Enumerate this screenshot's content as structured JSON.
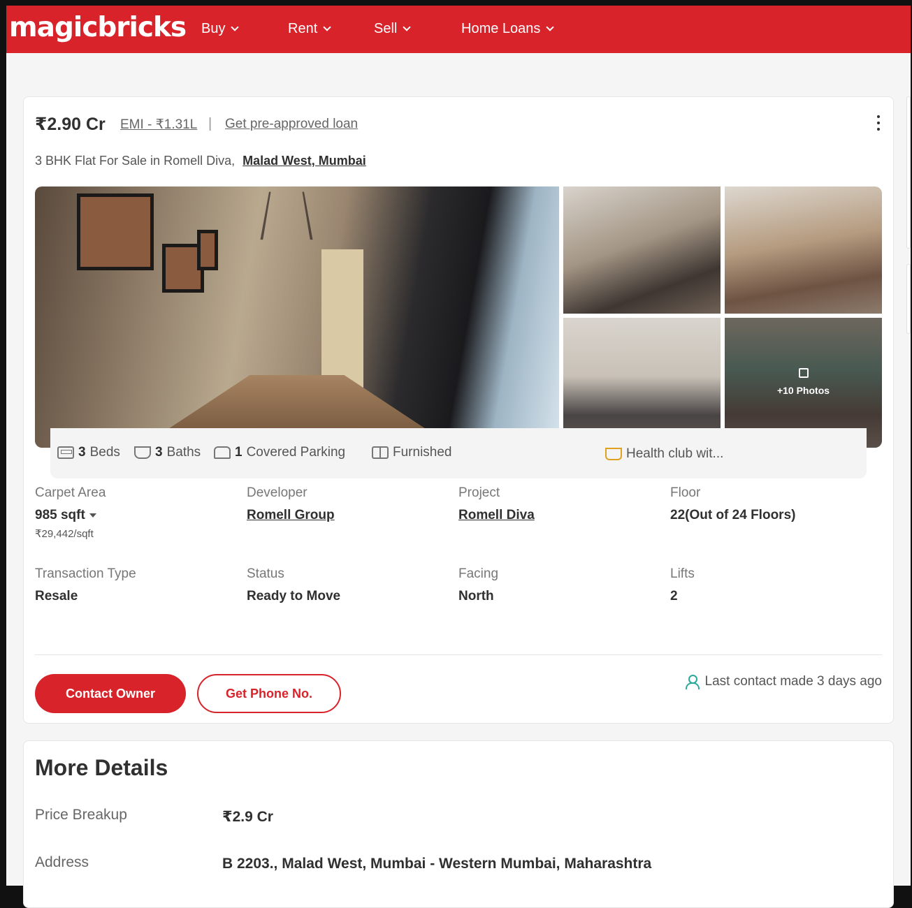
{
  "header": {
    "logo": "magicbricks",
    "nav": [
      {
        "label": "Buy"
      },
      {
        "label": "Rent"
      },
      {
        "label": "Sell"
      },
      {
        "label": "Home Loans"
      }
    ],
    "brand_color": "#d8232a"
  },
  "listing": {
    "price": "₹2.90 Cr",
    "emi": "EMI - ₹1.31L",
    "separator": "|",
    "loan_link": "Get pre-approved loan",
    "title_text": "3 BHK Flat For Sale in Romell Diva,",
    "location_link": "Malad West, Mumbai",
    "photos_label": "+10 Photos",
    "features": {
      "beds_count": "3",
      "beds_label": "Beds",
      "baths_count": "3",
      "baths_label": "Baths",
      "parking_count": "1",
      "parking_label": "Covered Parking",
      "furnishing": "Furnished",
      "amenity": "Health club wit..."
    },
    "details": {
      "carpet_area_label": "Carpet Area",
      "carpet_area_value": "985 sqft",
      "price_per_sqft": "₹29,442/sqft",
      "developer_label": "Developer",
      "developer_value": "Romell Group",
      "project_label": "Project",
      "project_value": "Romell Diva",
      "floor_label": "Floor",
      "floor_value": "22(Out of 24 Floors)",
      "transaction_label": "Transaction Type",
      "transaction_value": "Resale",
      "status_label": "Status",
      "status_value": "Ready to Move",
      "facing_label": "Facing",
      "facing_value": "North",
      "lifts_label": "Lifts",
      "lifts_value": "2"
    },
    "actions": {
      "contact_owner": "Contact Owner",
      "get_phone": "Get Phone No.",
      "last_contact": "Last contact made 3 days ago"
    }
  },
  "more_details": {
    "title": "More Details",
    "price_breakup_label": "Price Breakup",
    "price_breakup_value": "₹2.9 Cr",
    "address_label": "Address",
    "address_value": "B 2203., Malad West, Mumbai - Western Mumbai, Maharashtra"
  }
}
